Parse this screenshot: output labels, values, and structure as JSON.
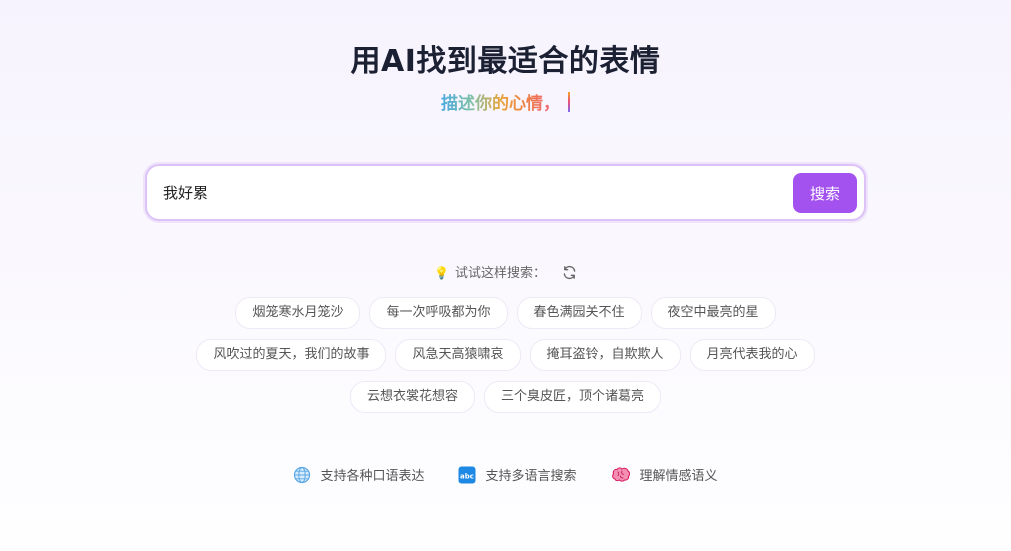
{
  "hero": {
    "title": "用AI找到最适合的表情",
    "subtitle": "描述你的心情，"
  },
  "search": {
    "value": "我好累",
    "button_label": "搜索"
  },
  "suggestions": {
    "prompt": "试试这样搜索：",
    "rows": [
      [
        "烟笼寒水月笼沙",
        "每一次呼吸都为你",
        "春色满园关不住",
        "夜空中最亮的星"
      ],
      [
        "风吹过的夏天，我们的故事",
        "风急天高猿啸哀",
        "掩耳盗铃，自欺欺人",
        "月亮代表我的心"
      ],
      [
        "云想衣裳花想容",
        "三个臭皮匠，顶个诸葛亮"
      ]
    ]
  },
  "features": [
    {
      "icon": "globe-icon",
      "label": "支持各种口语表达"
    },
    {
      "icon": "abc-icon",
      "label": "支持多语言搜索"
    },
    {
      "icon": "brain-icon",
      "label": "理解情感语义"
    }
  ],
  "colors": {
    "accent": "#a352f0",
    "border": "#dcc2f7"
  }
}
